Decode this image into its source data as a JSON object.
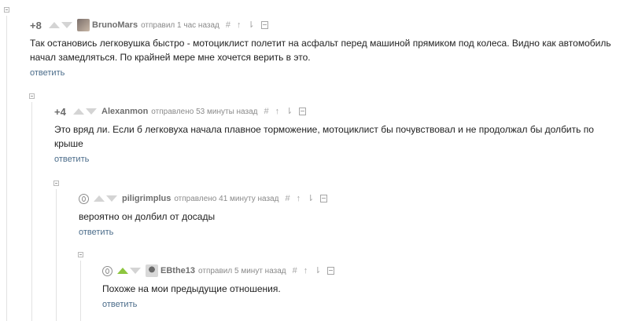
{
  "comments": [
    {
      "rating": "+8",
      "author": "BrunoMars",
      "timestamp": "отправил 1 час назад",
      "body": "Так остановись легковушка быстро - мотоциклист полетит на асфальт перед машиной прямиком под колеса. Видно как автомобиль начал замедляться. По крайней мере мне хочется верить в это.",
      "reply_label": "ответить",
      "icons": [
        "hash-icon",
        "up-arrow-icon",
        "branch-icon",
        "save-icon"
      ]
    },
    {
      "rating": "+4",
      "author": "Alexanmon",
      "timestamp": "отправлено 53 минуты назад",
      "body": "Это вряд ли. Если б легковуха начала плавное торможение, мотоциклист бы почувствовал и не продолжал бы долбить по крыше",
      "reply_label": "ответить",
      "icons": [
        "hash-icon",
        "up-arrow-icon",
        "branch-icon",
        "save-icon"
      ]
    },
    {
      "rating": "0",
      "author": "piligrimplus",
      "timestamp": "отправлено 41 минуту назад",
      "body": "вероятно он долбил от досады",
      "reply_label": "ответить",
      "icons": [
        "hash-icon",
        "up-arrow-icon",
        "branch-icon",
        "save-icon"
      ]
    },
    {
      "rating": "0",
      "author": "EBthe13",
      "timestamp": "отправил 5 минут назад",
      "body": "Похоже на мои предыдущие отношения.",
      "reply_label": "ответить",
      "upvoted": true,
      "icons": [
        "hash-icon",
        "up-arrow-icon",
        "branch-icon",
        "save-icon"
      ]
    }
  ],
  "glyphs": {
    "hash": "#",
    "up_arrow": "↑",
    "branch": "⇂"
  },
  "colors": {
    "link": "#4b6c8a",
    "upvote_active": "#8dc63f",
    "vote_idle": "#d4d4d4"
  }
}
